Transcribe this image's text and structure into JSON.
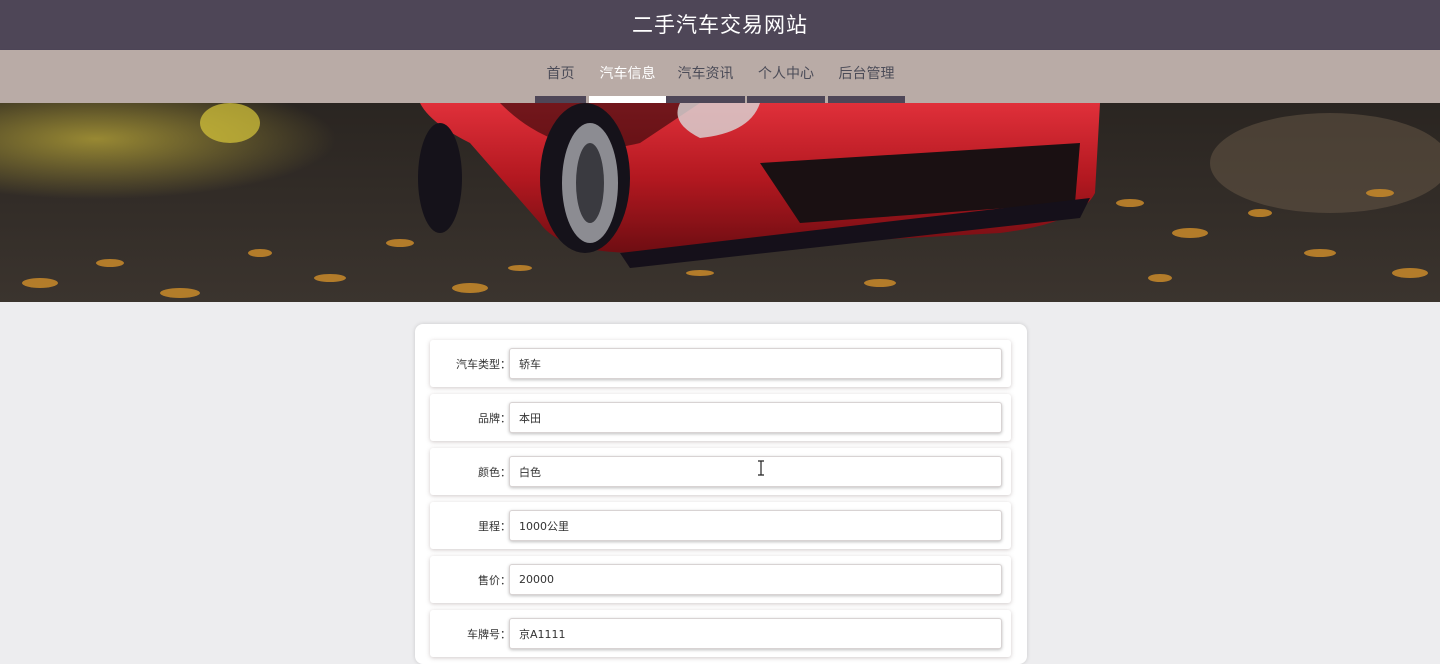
{
  "header": {
    "title": "二手汽车交易网站"
  },
  "nav": {
    "items": [
      {
        "label": "首页",
        "active": false
      },
      {
        "label": "汽车信息",
        "active": true
      },
      {
        "label": "汽车资讯",
        "active": false
      },
      {
        "label": "个人中心",
        "active": false
      },
      {
        "label": "后台管理",
        "active": false
      }
    ]
  },
  "banner": {
    "image": "red-sports-car-autumn-leaves",
    "slides": 4,
    "active_slide": 1
  },
  "form": {
    "fields": [
      {
        "label": "汽车类型：",
        "value": "轿车"
      },
      {
        "label": "品牌：",
        "value": "本田"
      },
      {
        "label": "颜色：",
        "value": "白色"
      },
      {
        "label": "里程：",
        "value": "1000公里"
      },
      {
        "label": "售价：",
        "value": "20000"
      },
      {
        "label": "车牌号：",
        "value": "京A1111"
      }
    ]
  },
  "colors": {
    "header_bg": "#4e4657",
    "nav_bg": "#b9aba6",
    "page_bg": "#ededef"
  }
}
